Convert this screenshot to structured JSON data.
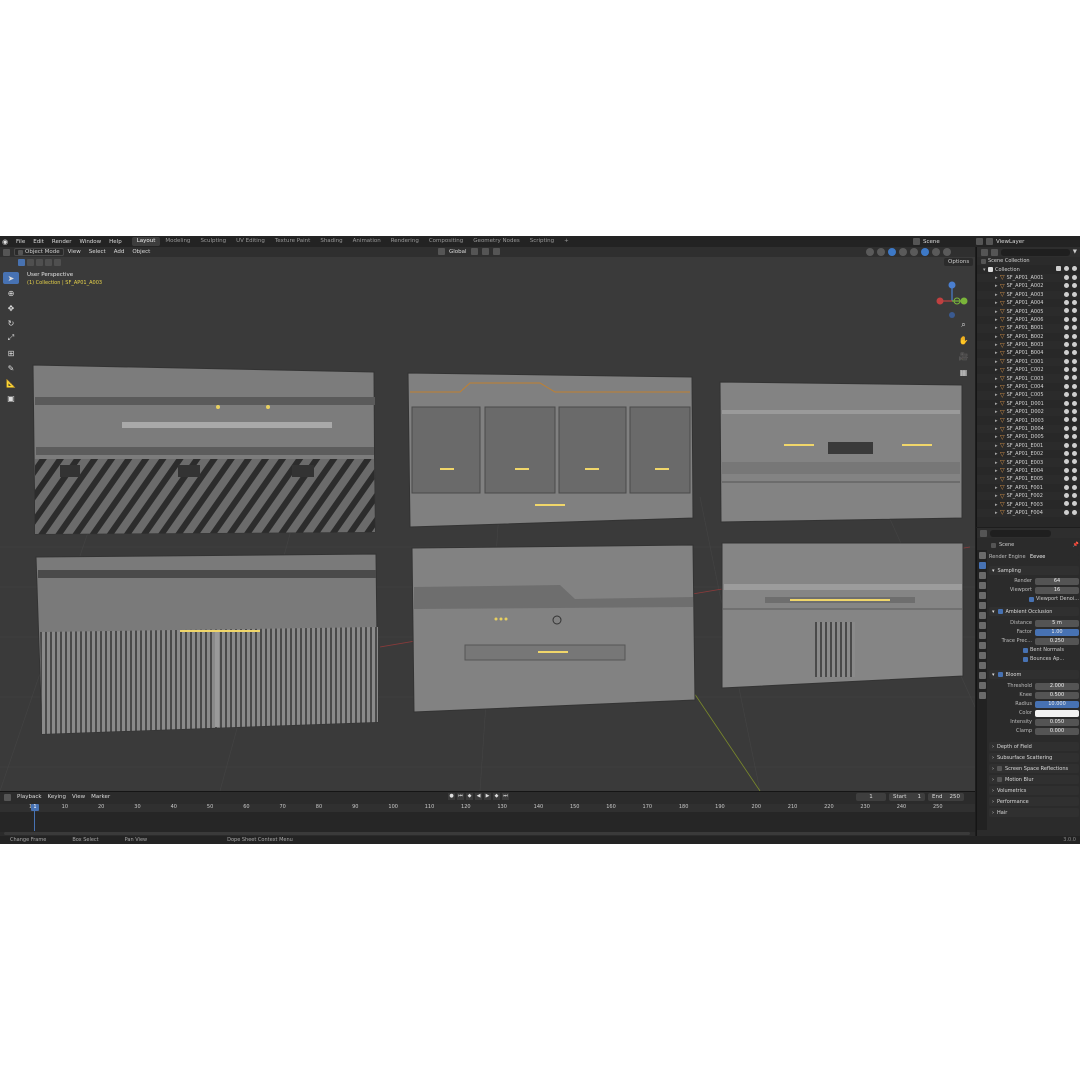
{
  "menu": [
    "File",
    "Edit",
    "Render",
    "Window",
    "Help"
  ],
  "workspace_tabs": [
    {
      "label": "Layout",
      "active": true
    },
    {
      "label": "Modeling"
    },
    {
      "label": "Sculpting"
    },
    {
      "label": "UV Editing"
    },
    {
      "label": "Texture Paint"
    },
    {
      "label": "Shading"
    },
    {
      "label": "Animation"
    },
    {
      "label": "Rendering"
    },
    {
      "label": "Compositing"
    },
    {
      "label": "Geometry Nodes"
    },
    {
      "label": "Scripting"
    }
  ],
  "add_tab": "+",
  "scene_name": "Scene",
  "view_layer": "ViewLayer",
  "viewport": {
    "mode": "Object Mode",
    "header_menu": [
      "View",
      "Select",
      "Add",
      "Object"
    ],
    "orientation": "Global",
    "options_label": "Options",
    "perspective": "User Perspective",
    "collection_path": "(1) Collection | SF_AP01_A003"
  },
  "timeline": {
    "menu": [
      "Playback",
      "Keying",
      "View",
      "Marker"
    ],
    "current_frame": "1",
    "start_label": "Start",
    "start_value": "1",
    "end_label": "End",
    "end_value": "250",
    "ruler": [
      "1",
      "10",
      "20",
      "30",
      "40",
      "50",
      "60",
      "70",
      "80",
      "90",
      "100",
      "110",
      "120",
      "130",
      "140",
      "150",
      "160",
      "170",
      "180",
      "190",
      "200",
      "210",
      "220",
      "230",
      "240",
      "250"
    ]
  },
  "status": {
    "change_frame": "Change Frame",
    "box_select": "Box Select",
    "pan_view": "Pan View",
    "context": "Dope Sheet Context Menu",
    "version": "3.0.0"
  },
  "outliner": {
    "scene_collection": "Scene Collection",
    "collection": "Collection",
    "items": [
      "SF_AP01_A001",
      "SF_AP01_A002",
      "SF_AP01_A003",
      "SF_AP01_A004",
      "SF_AP01_A005",
      "SF_AP01_A006",
      "SF_AP01_B001",
      "SF_AP01_B002",
      "SF_AP01_B003",
      "SF_AP01_B004",
      "SF_AP01_C001",
      "SF_AP01_C002",
      "SF_AP01_C003",
      "SF_AP01_C004",
      "SF_AP01_C005",
      "SF_AP01_D001",
      "SF_AP01_D002",
      "SF_AP01_D003",
      "SF_AP01_D004",
      "SF_AP01_D005",
      "SF_AP01_E001",
      "SF_AP01_E002",
      "SF_AP01_E003",
      "SF_AP01_E004",
      "SF_AP01_E005",
      "SF_AP01_F001",
      "SF_AP01_F002",
      "SF_AP01_F003",
      "SF_AP01_F004"
    ]
  },
  "properties": {
    "scene_label": "Scene",
    "render_engine_label": "Render Engine",
    "render_engine": "Eevee",
    "sampling": "Sampling",
    "render_label": "Render",
    "render_value": "64",
    "viewport_label": "Viewport",
    "viewport_value": "16",
    "viewport_denoise": "Viewport Denoi...",
    "ambient_occlusion": "Ambient Occlusion",
    "distance_label": "Distance",
    "distance_value": "5 m",
    "factor_label": "Factor",
    "factor_value": "1.00",
    "trace_label": "Trace Prec...",
    "trace_value": "0.250",
    "bent_normals": "Bent Normals",
    "bounces": "Bounces Ap...",
    "bloom": "Bloom",
    "threshold_label": "Threshold",
    "threshold_value": "2.000",
    "knee_label": "Knee",
    "knee_value": "0.500",
    "radius_label": "Radius",
    "radius_value": "10.000",
    "color_label": "Color",
    "intensity_label": "Intensity",
    "intensity_value": "0.050",
    "clamp_label": "Clamp",
    "clamp_value": "0.000",
    "sections": [
      "Depth of Field",
      "Subsurface Scattering",
      "Screen Space Reflections",
      "Motion Blur",
      "Volumetrics",
      "Performance",
      "Hair"
    ]
  },
  "colors": {
    "accent": "#4772b3",
    "object_icon": "#e39a4a",
    "path_text": "#e8d34a"
  }
}
